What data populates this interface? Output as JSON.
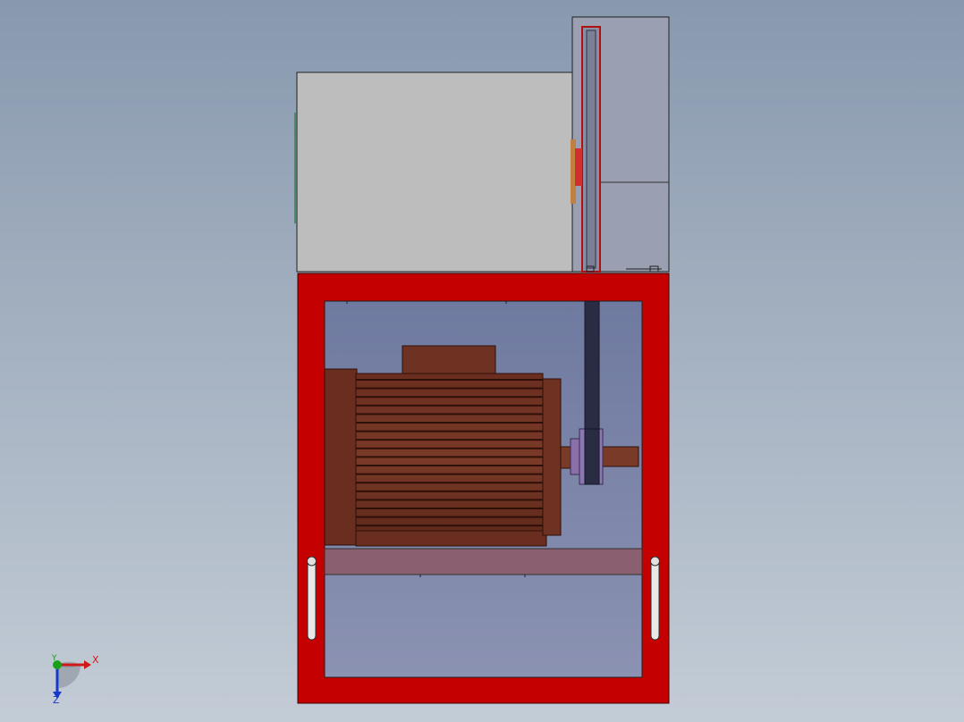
{
  "viewport": {
    "background_top": "#8899ae",
    "background_bottom": "#c3ccd6"
  },
  "triad": {
    "x_label": "X",
    "y_label": "Y",
    "z_label": "Z",
    "x_color": "#d01818",
    "y_color": "#18a018",
    "z_color": "#1838c8"
  },
  "model": {
    "frame_color": "#c80000",
    "motor_color": "#6e3222",
    "housing_color": "#bebebe",
    "guard_color": "#9aa2b4",
    "belt_color": "#2a2a40",
    "pulley_color": "#8a70a8"
  }
}
